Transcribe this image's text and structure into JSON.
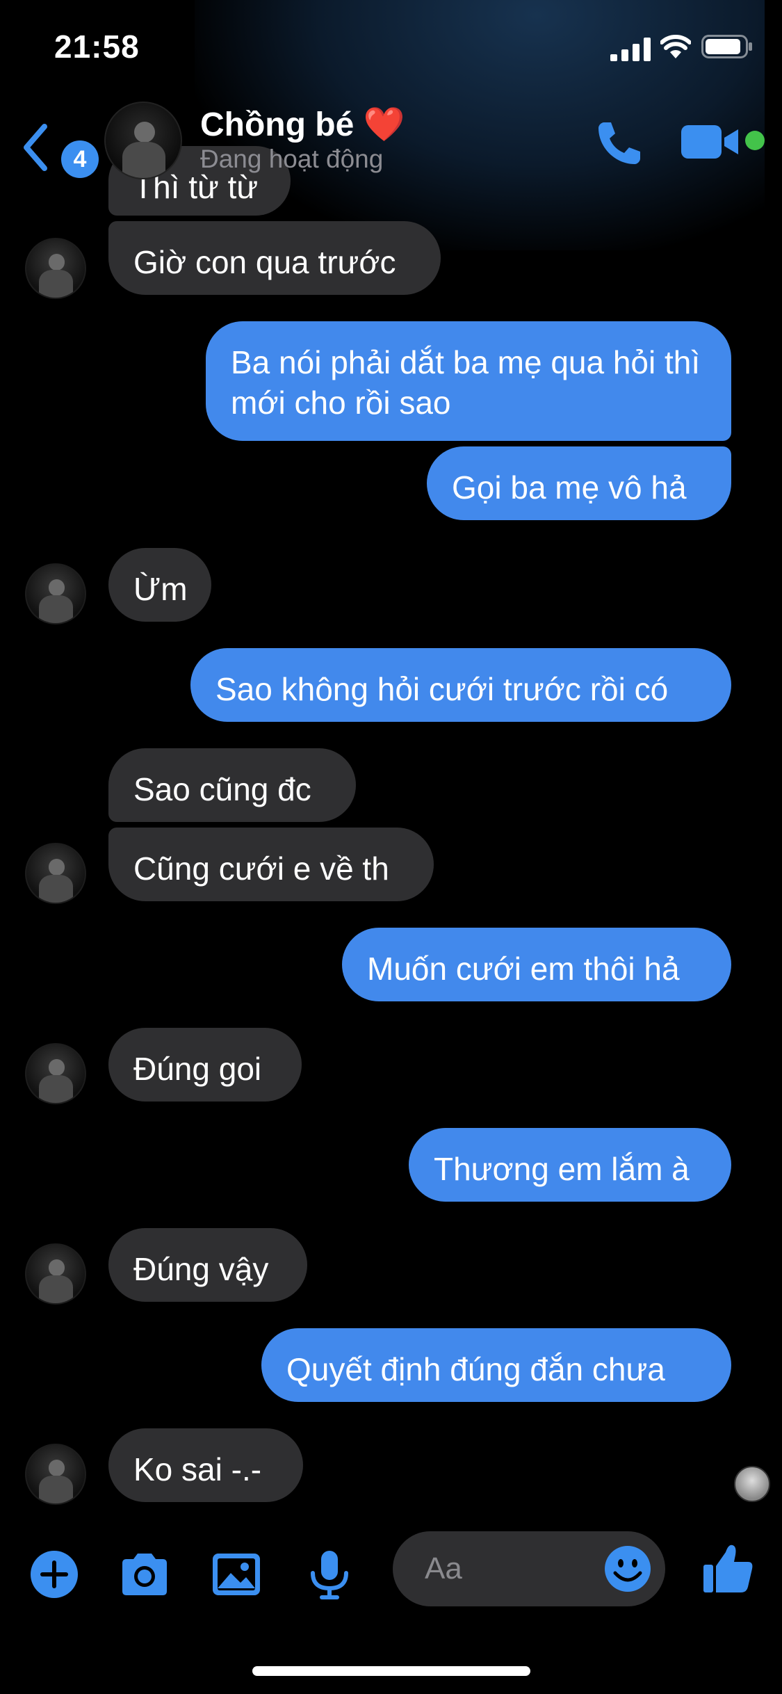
{
  "status_bar": {
    "time": "21:58"
  },
  "header": {
    "back_badge": "4",
    "contact_name": "Chồng bé ❤️",
    "status": "Đang hoạt động"
  },
  "messages": [
    {
      "from": "them",
      "text": "Thì từ từ"
    },
    {
      "from": "them",
      "text": "Giờ con qua trước"
    },
    {
      "from": "me",
      "text": "Ba nói phải dắt ba mẹ qua hỏi thì mới cho rồi sao"
    },
    {
      "from": "me",
      "text": "Gọi ba mẹ vô hả"
    },
    {
      "from": "them",
      "text": "Ừm"
    },
    {
      "from": "me",
      "text": "Sao không hỏi cưới trước rồi có"
    },
    {
      "from": "them",
      "text": "Sao cũng đc"
    },
    {
      "from": "them",
      "text": "Cũng cưới e về th"
    },
    {
      "from": "me",
      "text": "Muốn cưới em thôi hả"
    },
    {
      "from": "them",
      "text": "Đúng goi"
    },
    {
      "from": "me",
      "text": "Thương em lắm à"
    },
    {
      "from": "them",
      "text": "Đúng vậy"
    },
    {
      "from": "me",
      "text": "Quyết định đúng đắn chưa"
    },
    {
      "from": "them",
      "text": "Ko sai -.-"
    }
  ],
  "composer": {
    "placeholder": "Aa"
  },
  "colors": {
    "outgoing_bubble": "#4289ec",
    "incoming_bubble": "#2f2f31",
    "accent": "#3b8ff0",
    "online": "#43c34a"
  },
  "icons": [
    "back-chevron-icon",
    "phone-icon",
    "video-camera-icon",
    "plus-icon",
    "camera-icon",
    "image-icon",
    "microphone-icon",
    "emoji-icon",
    "thumbs-up-icon"
  ]
}
